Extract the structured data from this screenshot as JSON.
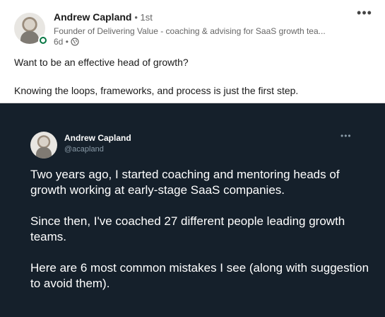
{
  "post": {
    "author": {
      "name": "Andrew Capland",
      "degree": "1st",
      "headline": "Founder of Delivering Value - coaching & advising for SaaS growth tea...",
      "time": "6d"
    },
    "more_label": "•••",
    "text": [
      "Want to be an effective head of growth?",
      "Knowing the loops, frameworks, and process is just the first step."
    ]
  },
  "tweet": {
    "name": "Andrew Capland",
    "handle": "@acapland",
    "more_label": "•••",
    "paragraphs": [
      "Two years ago, I started coaching and mentoring heads of growth working at early-stage SaaS companies.",
      "Since then, I've coached 27 different people leading growth teams.",
      "Here are 6 most common mistakes I see (along with suggestion to avoid them)."
    ]
  },
  "icons": {
    "visibility": "globe-icon",
    "status": "online-dot-icon"
  },
  "colors": {
    "tweet_background": "#15202b",
    "online_status": "#057642"
  }
}
